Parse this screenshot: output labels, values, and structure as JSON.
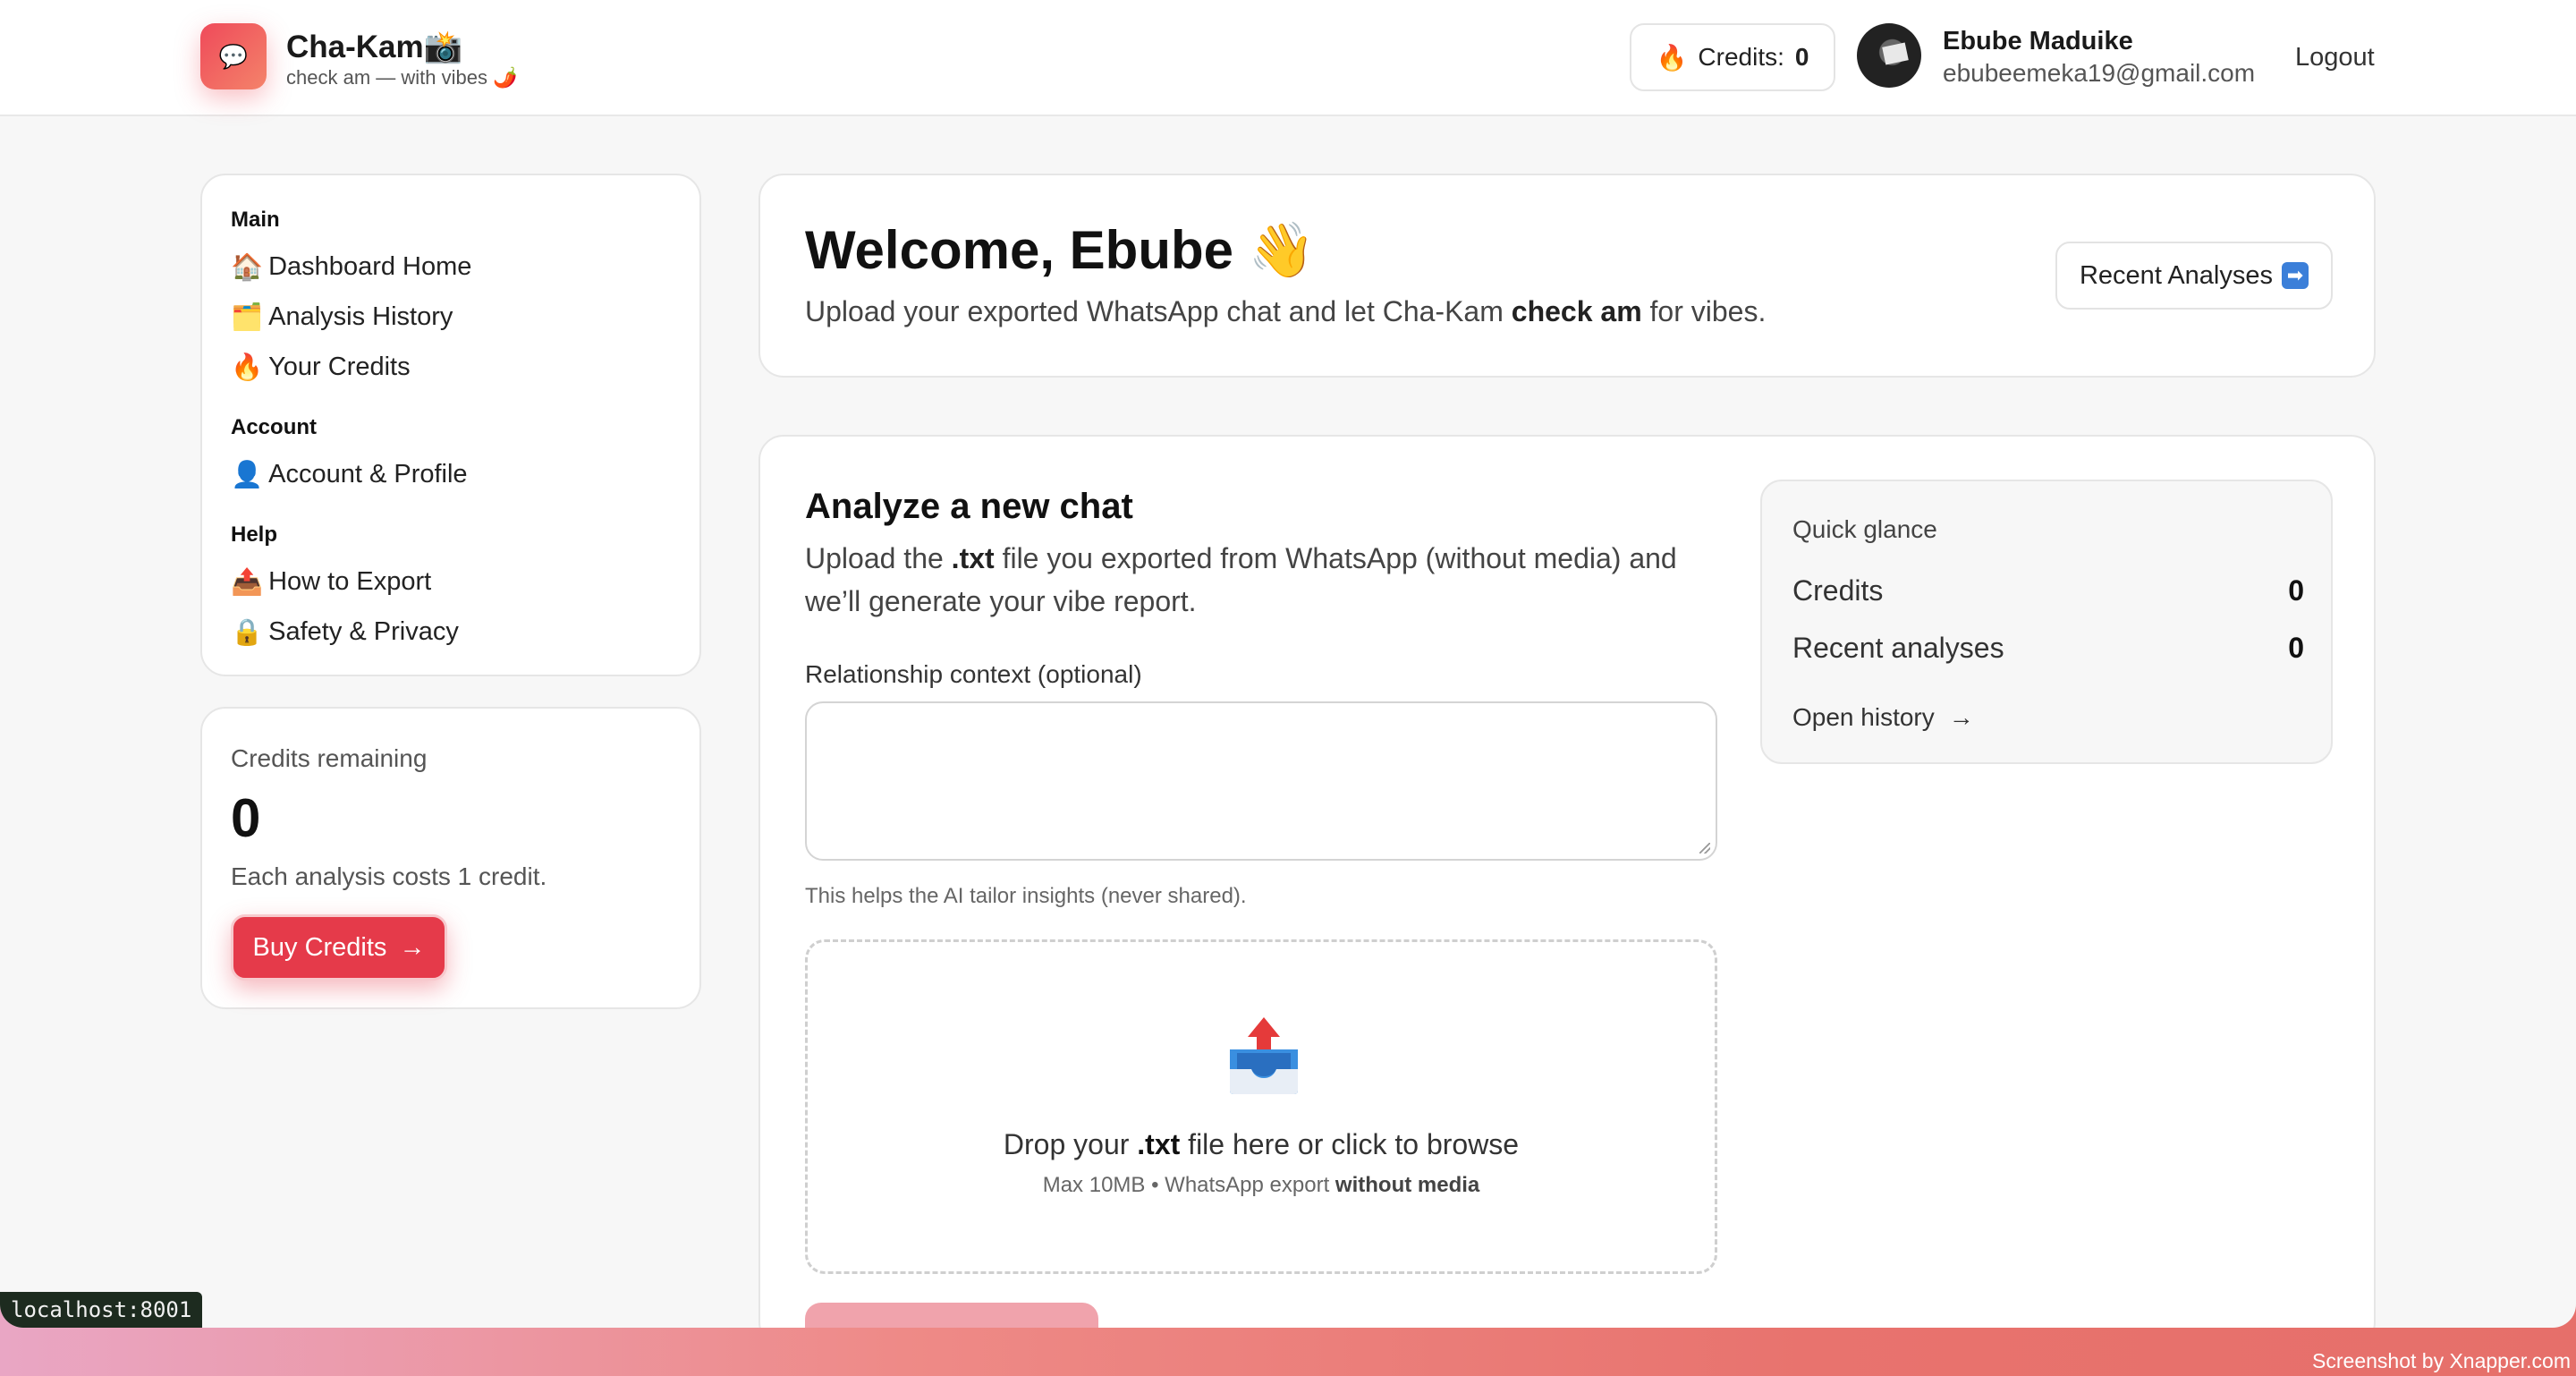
{
  "brand": {
    "logo_glyph": "💬",
    "name": "Cha-Kam📸",
    "tagline": "check am — with vibes 🌶️",
    "accent_color": "#e53a4a"
  },
  "header": {
    "credits_icon": "🔥",
    "credits_label": "Credits:",
    "credits_value": "0",
    "user_name": "Ebube Maduike",
    "user_email": "ebubeemeka19@gmail.com",
    "logout_label": "Logout"
  },
  "sidebar": {
    "sections": [
      {
        "title": "Main",
        "items": [
          {
            "icon": "🏠",
            "label": "Dashboard Home"
          },
          {
            "icon": "🗂️",
            "label": "Analysis History"
          },
          {
            "icon": "🔥",
            "label": "Your Credits"
          }
        ]
      },
      {
        "title": "Account",
        "items": [
          {
            "icon": "👤",
            "label": "Account & Profile"
          }
        ]
      },
      {
        "title": "Help",
        "items": [
          {
            "icon": "📤",
            "label": "How to Export"
          },
          {
            "icon": "🔒",
            "label": "Safety & Privacy"
          }
        ]
      }
    ]
  },
  "credits_card": {
    "title": "Credits remaining",
    "value": "0",
    "description": "Each analysis costs 1 credit.",
    "buy_label": "Buy Credits",
    "buy_arrow": "→"
  },
  "welcome": {
    "title": "Welcome, Ebube 👋",
    "subtitle_pre": "Upload your exported WhatsApp chat and let Cha-Kam ",
    "subtitle_bold": "check am",
    "subtitle_post": " for vibes.",
    "recent_button": "Recent Analyses",
    "recent_icon": "➡"
  },
  "analyze": {
    "title": "Analyze a new chat",
    "desc_pre": "Upload the ",
    "desc_bold": ".txt",
    "desc_post": " file you exported from WhatsApp (without media) and we’ll generate your vibe report.",
    "context_label": "Relationship context (optional)",
    "context_value": "",
    "context_help": "This helps the AI tailor insights (never shared).",
    "drop_pre": "Drop your ",
    "drop_bold": ".txt",
    "drop_post": " file here or click to browse",
    "drop_sub_pre": "Max 10MB • WhatsApp export ",
    "drop_sub_bold": "without media"
  },
  "quick_glance": {
    "title": "Quick glance",
    "rows": [
      {
        "label": "Credits",
        "value": "0"
      },
      {
        "label": "Recent analyses",
        "value": "0"
      }
    ],
    "link_label": "Open history",
    "link_arrow": "→"
  },
  "statusbar": {
    "url": "localhost:8001"
  },
  "watermark": "Screenshot by Xnapper.com"
}
